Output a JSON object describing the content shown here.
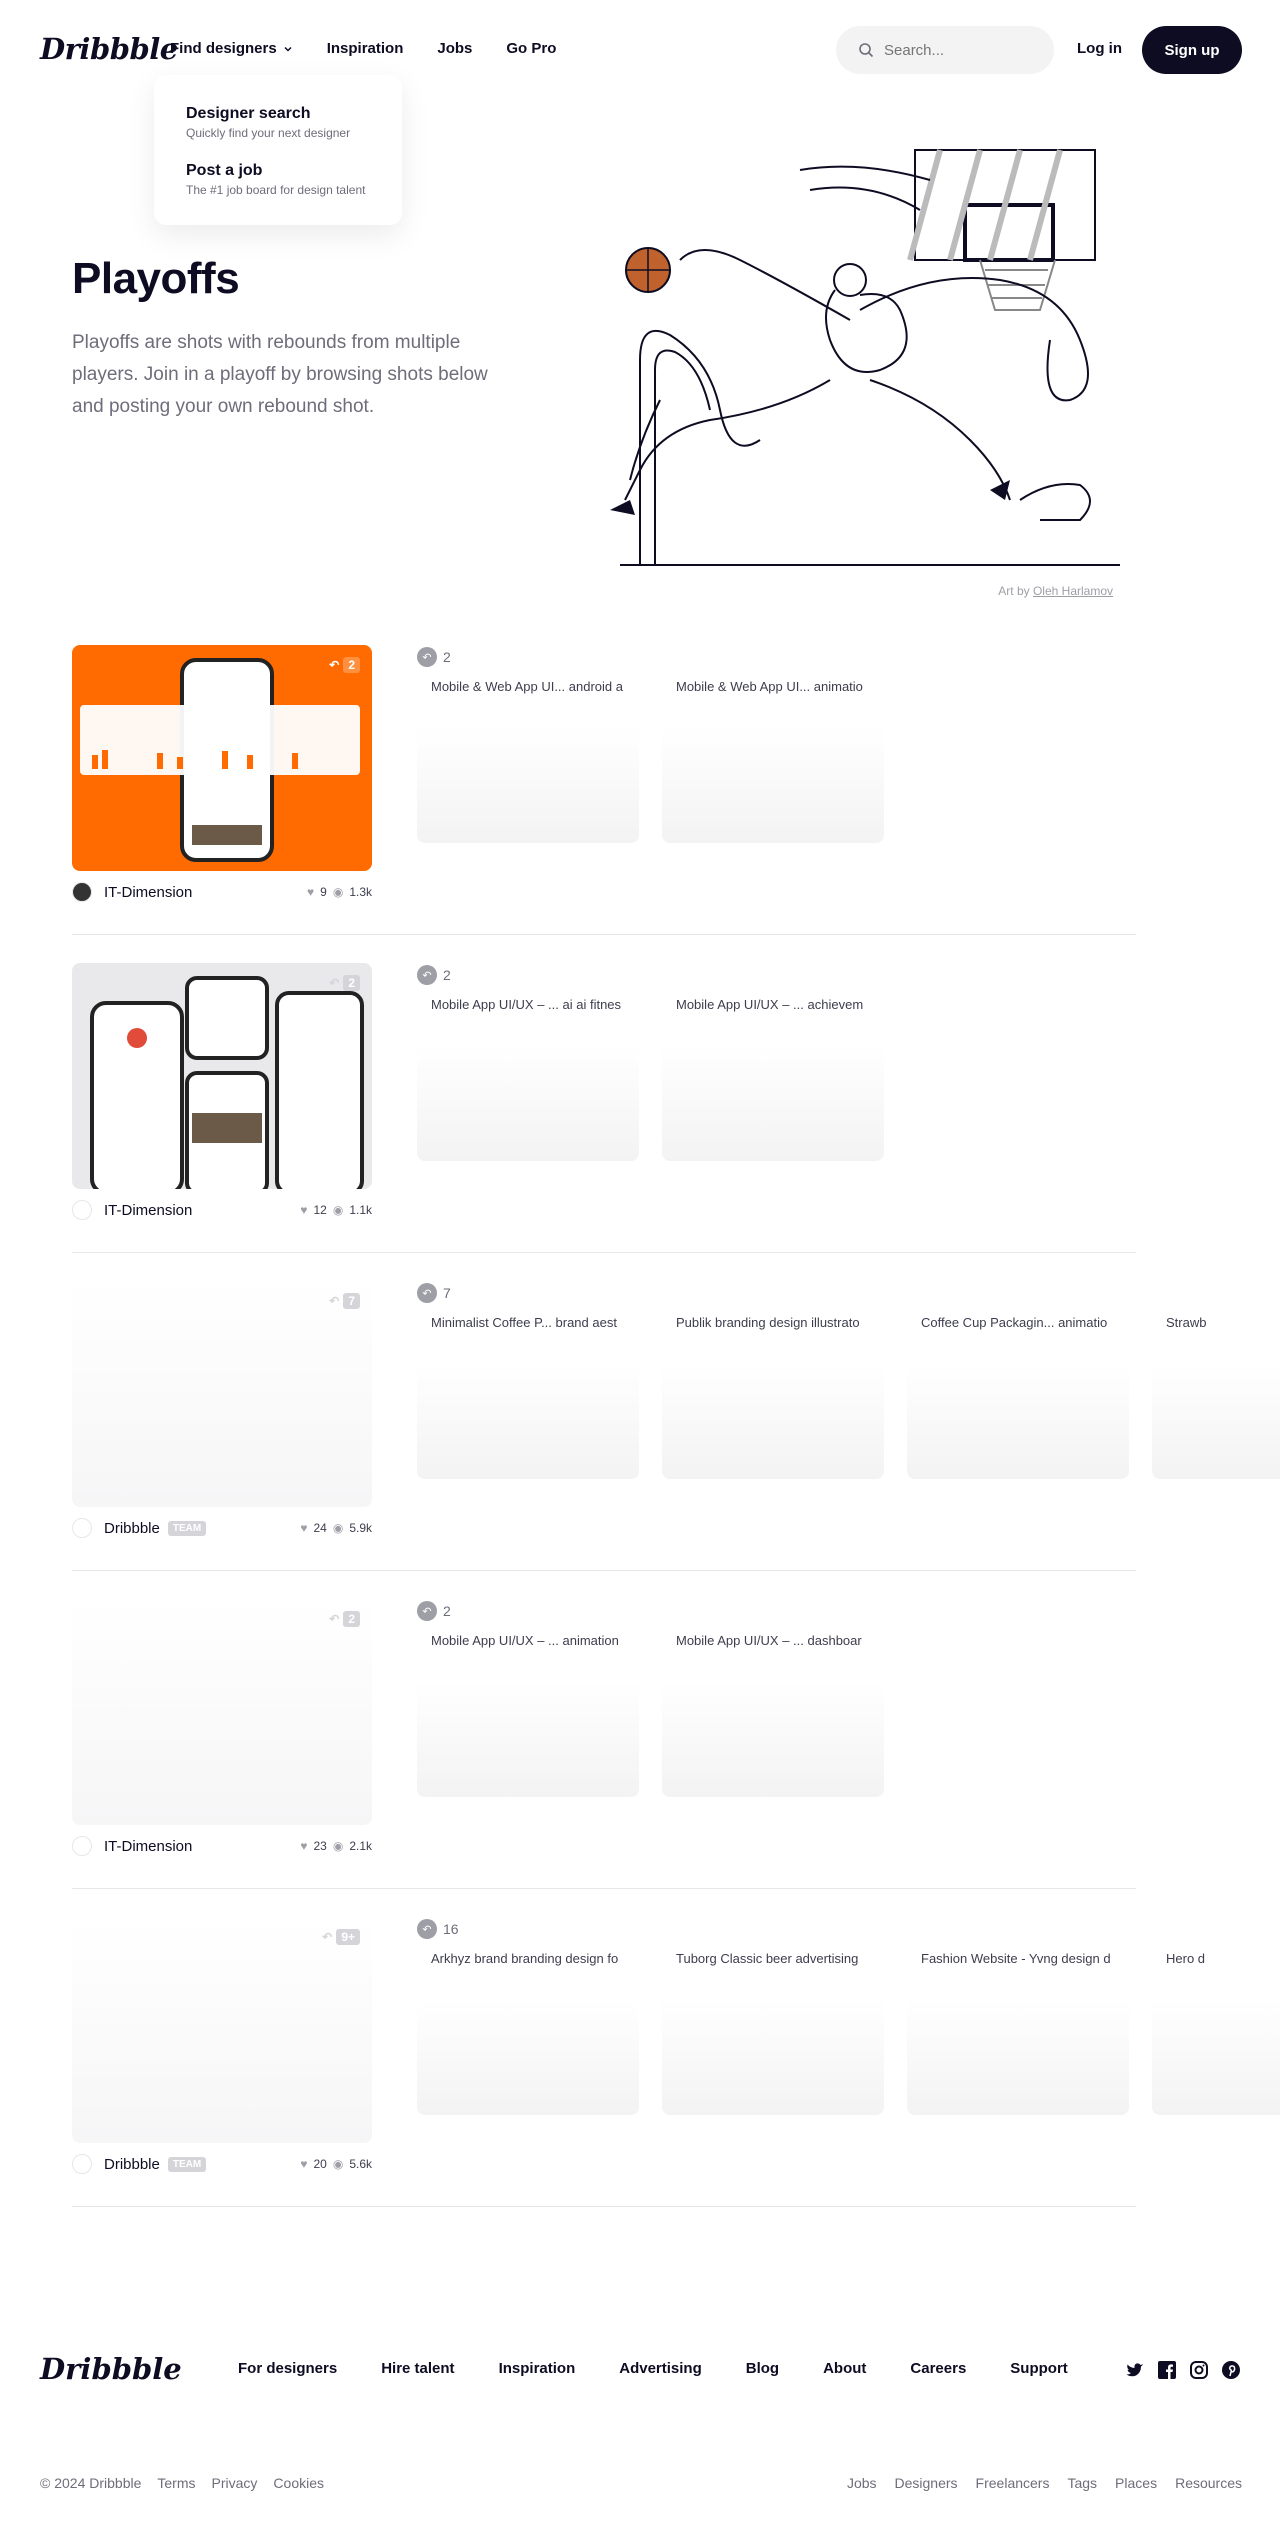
{
  "nav": {
    "logo": "Dribbble",
    "links": [
      "Find designers",
      "Inspiration",
      "Jobs",
      "Go Pro"
    ],
    "search_placeholder": "Search...",
    "login": "Log in",
    "signup": "Sign up"
  },
  "dropdown": {
    "items": [
      {
        "title": "Designer search",
        "desc": "Quickly find your next designer"
      },
      {
        "title": "Post a job",
        "desc": "The #1 job board for design talent"
      }
    ]
  },
  "hero": {
    "title": "Playoffs",
    "description": "Playoffs are shots with rebounds from multiple players. Join in a playoff by browsing shots below and posting your own rebound shot.",
    "art_credit_prefix": "Art by",
    "art_credit_name": "Oleh Harlamov"
  },
  "playoffs": [
    {
      "author": "IT-Dimension",
      "team": "",
      "likes": "9",
      "views": "1.3k",
      "rebound_badge": "2",
      "rebound_count": "2",
      "rebounds": [
        "Mobile & Web App UI... android a",
        "Mobile & Web App UI... animatio"
      ]
    },
    {
      "author": "IT-Dimension",
      "team": "",
      "likes": "12",
      "views": "1.1k",
      "rebound_badge": "2",
      "rebound_count": "2",
      "rebounds": [
        "Mobile App UI/UX – ... ai ai fitnes",
        "Mobile App UI/UX – ... achievem"
      ]
    },
    {
      "author": "Dribbble",
      "team": "TEAM",
      "likes": "24",
      "views": "5.9k",
      "rebound_badge": "7",
      "rebound_count": "7",
      "rebounds": [
        "Minimalist Coffee P... brand aest",
        "Publik branding design illustrato",
        "Coffee Cup Packagin... animatio",
        "Strawb"
      ]
    },
    {
      "author": "IT-Dimension",
      "team": "",
      "likes": "23",
      "views": "2.1k",
      "rebound_badge": "2",
      "rebound_count": "2",
      "rebounds": [
        "Mobile App UI/UX – ... animation",
        "Mobile App UI/UX – ... dashboar"
      ]
    },
    {
      "author": "Dribbble",
      "team": "TEAM",
      "likes": "20",
      "views": "5.6k",
      "rebound_badge": "9+",
      "rebound_count": "16",
      "rebounds": [
        "Arkhyz brand branding design fo",
        "Tuborg Classic beer advertising",
        "Fashion Website - Yvng design d",
        "Hero d"
      ]
    }
  ],
  "footer": {
    "logo": "Dribbble",
    "links": [
      "For designers",
      "Hire talent",
      "Inspiration",
      "Advertising",
      "Blog",
      "About",
      "Careers",
      "Support"
    ],
    "social": [
      "twitter-icon",
      "facebook-icon",
      "instagram-icon",
      "pinterest-icon"
    ],
    "copyright": "© 2024 Dribbble",
    "legal": [
      "Terms",
      "Privacy",
      "Cookies"
    ],
    "bottom_links": [
      "Jobs",
      "Designers",
      "Freelancers",
      "Tags",
      "Places",
      "Resources"
    ]
  },
  "colors": {
    "accent": "#0d0c22",
    "shot_orange": "#ff6b00"
  }
}
